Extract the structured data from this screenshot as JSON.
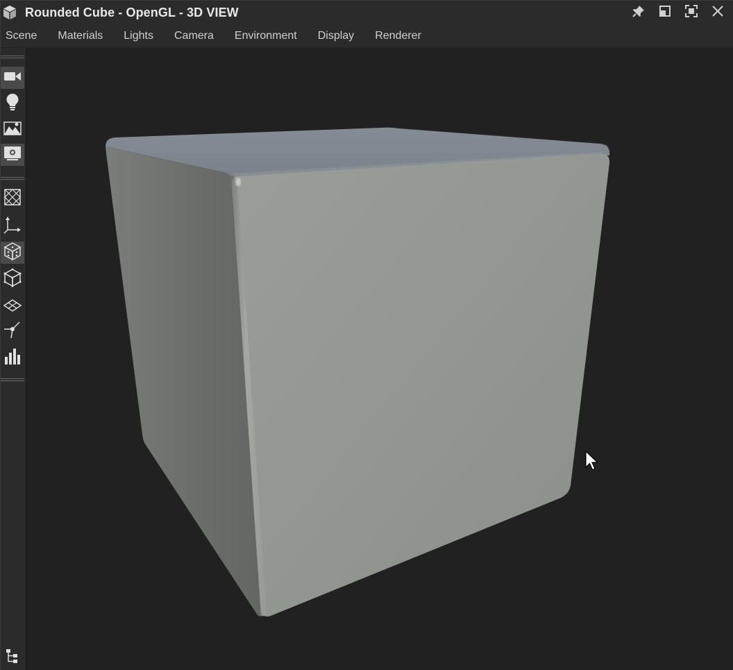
{
  "window": {
    "title": "Rounded Cube - OpenGL - 3D VIEW",
    "app_icon": "cube-icon",
    "controls": [
      "pin-icon",
      "restore-icon",
      "maximize-icon",
      "close-icon"
    ]
  },
  "menu": {
    "items": [
      "Scene",
      "Materials",
      "Lights",
      "Camera",
      "Environment",
      "Display",
      "Renderer"
    ]
  },
  "toolbar": {
    "buttons": [
      {
        "icon": "camera-icon",
        "active": true
      },
      {
        "icon": "light-bulb-icon",
        "active": false
      },
      {
        "icon": "environment-image-icon",
        "active": false
      },
      {
        "icon": "render-settings-icon",
        "active": true
      },
      {
        "icon": "wireframe-icon",
        "active": false
      },
      {
        "icon": "axes-icon",
        "active": false
      },
      {
        "icon": "shaded-cube-icon",
        "active": true
      },
      {
        "icon": "wire-cube-icon",
        "active": false
      },
      {
        "icon": "ground-plane-icon",
        "active": false
      },
      {
        "icon": "light-gizmo-icon",
        "active": false
      },
      {
        "icon": "statistics-icon",
        "active": false
      },
      {
        "icon": "scene-tree-icon",
        "active": false
      }
    ]
  },
  "colors": {
    "background": "#212121",
    "panel": "#2b2b2b",
    "text": "#d0d0d0",
    "cube_top": "#7d858d",
    "cube_left": "#6e706d",
    "cube_front": "#929690"
  }
}
